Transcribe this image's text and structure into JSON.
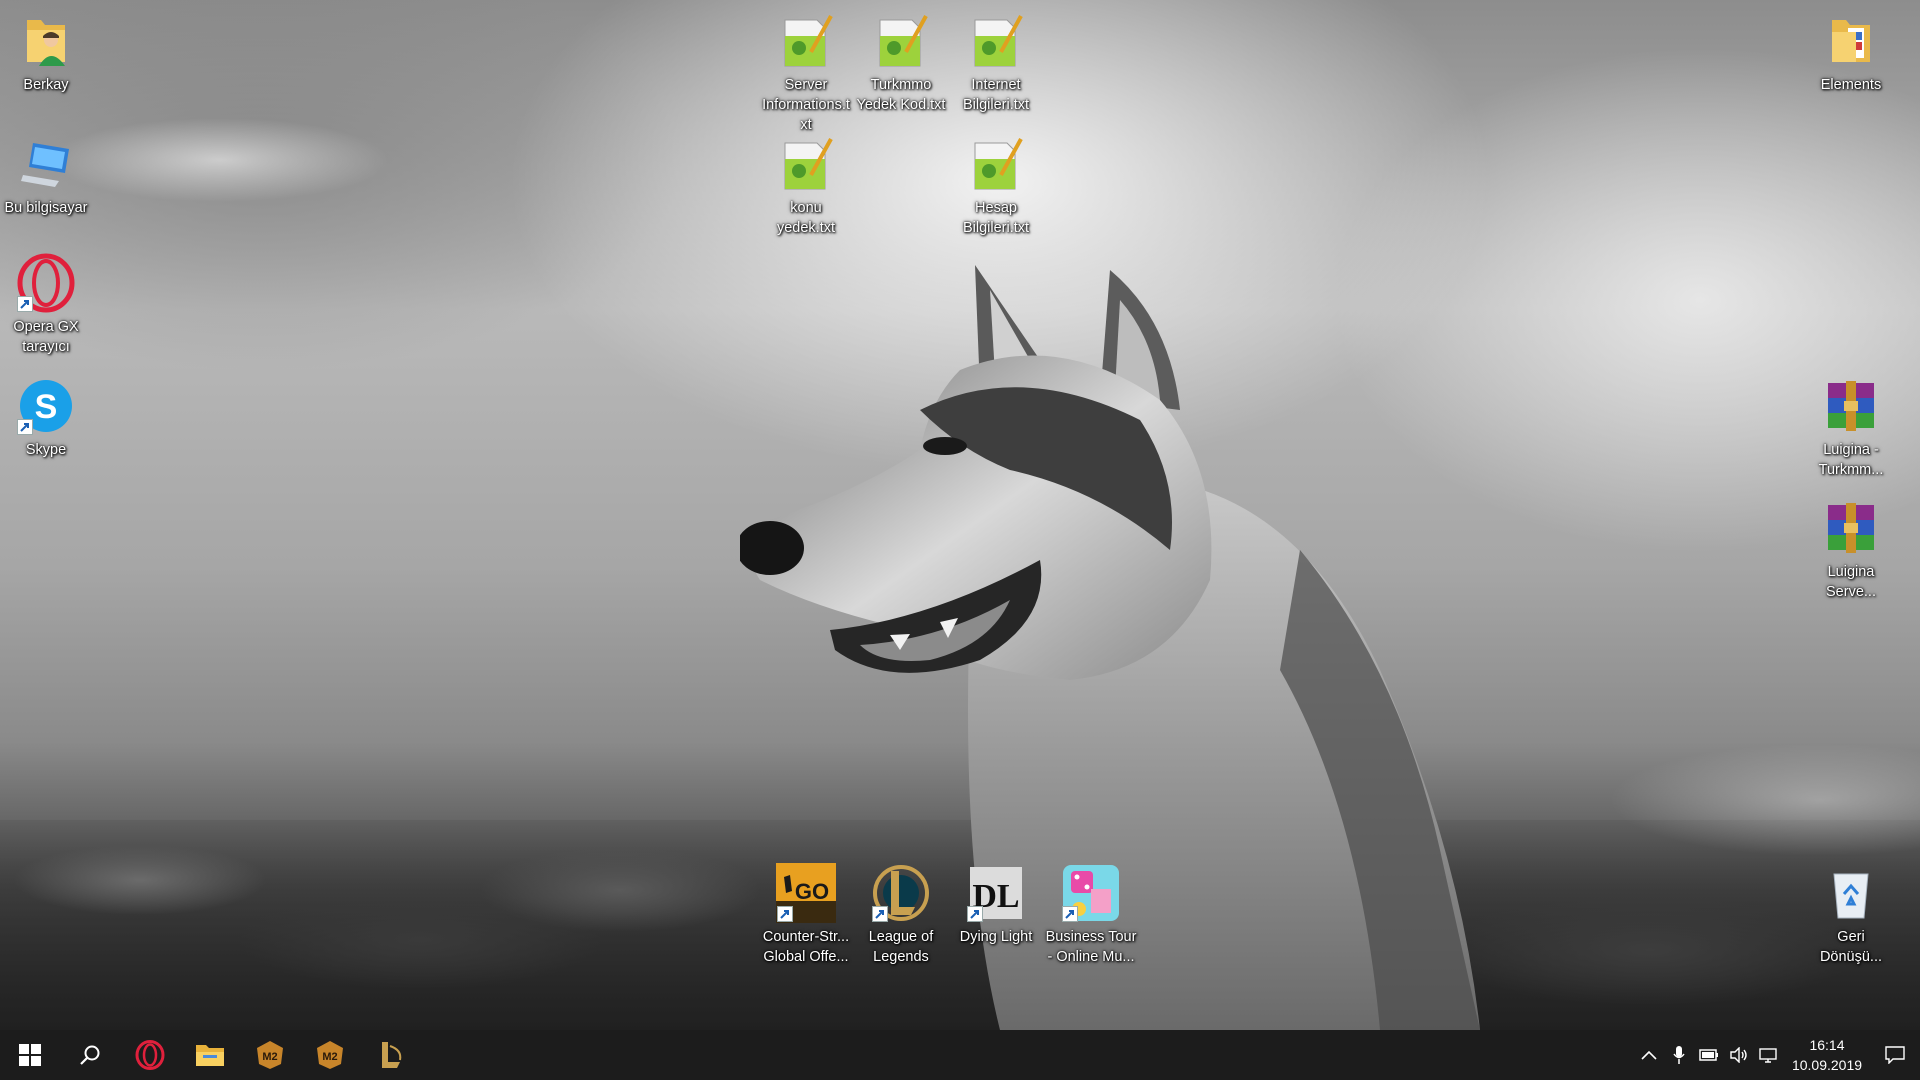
{
  "desktop": {
    "icons": {
      "berkay": "Berkay",
      "this_pc": "Bu bilgisayar",
      "opera": "Opera GX tarayıcı",
      "skype": "Skype",
      "server_info": "Server Informations.txt",
      "turkmmo": "Turkmmo Yedek Kod.txt",
      "internet": "Internet Bilgileri.txt",
      "konu": "konu yedek.txt",
      "hesap": "Hesap Bilgileri.txt",
      "elements": "Elements",
      "luigina_turkmmo": "Luigina - Turkmm...",
      "luigina_server": "Luigina Serve...",
      "csgo": "Counter-Str... Global Offe...",
      "lol": "League of Legends",
      "dying_light": "Dying Light",
      "business_tour": "Business Tour - Online Mu...",
      "recycle_bin": "Geri Dönüşü..."
    },
    "icon_names": {
      "berkay": "user-folder-icon",
      "this_pc": "computer-icon",
      "opera": "opera-gx-icon",
      "skype": "skype-icon",
      "text": "notepad-text-file-icon",
      "elements": "folder-icon",
      "archive": "winrar-archive-icon",
      "csgo": "csgo-icon",
      "lol": "league-of-legends-icon",
      "dying_light": "dying-light-icon",
      "business_tour": "business-tour-icon",
      "recycle_bin": "recycle-bin-icon"
    }
  },
  "taskbar": {
    "pinned": [
      "start-icon",
      "search-icon",
      "opera-gx-icon",
      "file-explorer-icon",
      "metin2-icon",
      "metin2-icon",
      "league-of-legends-icon"
    ],
    "tray": [
      "chevron-up-icon",
      "microphone-icon",
      "battery-icon",
      "volume-icon",
      "network-icon"
    ],
    "clock": {
      "time": "16:14",
      "date": "10.09.2019"
    }
  },
  "colors": {
    "taskbar_bg": "#1c1c1c",
    "opera_red": "#e0203c",
    "skype_blue": "#1aa0e8"
  }
}
